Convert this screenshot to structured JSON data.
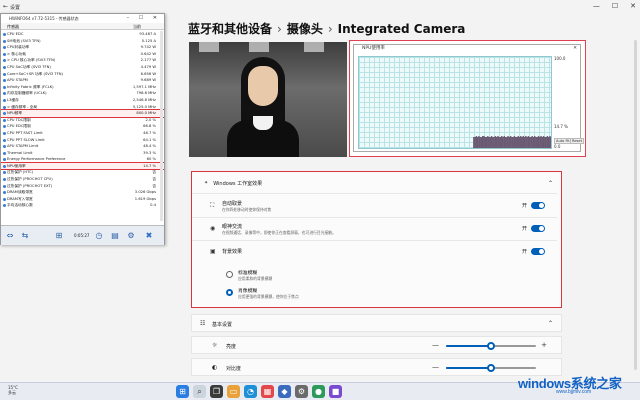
{
  "titlebar": {
    "app_title": "设置",
    "back": "←",
    "minimize": "—",
    "maximize": "☐",
    "close": "✕"
  },
  "breadcrumb": {
    "part1": "蓝牙和其他设备",
    "sep": "›",
    "part2": "摄像头",
    "part3": "Integrated Camera"
  },
  "npu_window": {
    "title": "NPU使用率",
    "close": "✕",
    "axis_top": "100.0",
    "axis_current": "14.7 %",
    "axis_bottom": "0.0",
    "btn_auto": "Auto Fit",
    "btn_reset": "Reset",
    "chart_data": {
      "type": "bar",
      "ylim": [
        0,
        100
      ],
      "values": [
        0,
        0,
        0,
        0,
        0,
        0,
        0,
        0,
        0,
        0,
        0,
        0,
        0,
        0,
        0,
        0,
        0,
        0,
        0,
        0,
        0,
        0,
        0,
        0,
        0,
        0,
        0,
        0,
        0,
        0,
        0,
        0,
        0,
        0,
        0,
        0,
        0,
        0,
        0,
        0,
        0,
        0,
        0,
        0,
        0,
        0,
        0,
        0,
        0,
        0,
        0,
        0,
        0,
        0,
        0,
        0,
        0,
        0,
        0,
        0,
        0,
        0,
        0,
        0,
        0,
        0,
        0,
        0,
        0,
        0,
        0,
        0,
        0,
        0,
        0,
        0,
        0,
        0,
        0,
        0,
        0,
        0,
        0,
        0,
        0,
        0,
        0,
        0,
        0,
        0,
        14,
        14,
        15,
        14,
        15,
        14,
        14,
        15,
        15,
        14,
        14,
        15,
        14,
        14,
        15,
        14,
        14,
        15,
        14,
        15,
        14,
        14,
        15,
        14,
        15,
        14,
        14,
        15,
        14,
        15,
        14,
        14,
        15,
        14,
        14,
        15,
        14,
        15,
        14,
        15,
        14,
        15,
        14,
        15,
        14,
        14,
        15,
        14,
        15,
        14,
        14,
        15,
        14,
        15,
        14,
        15,
        14,
        14,
        15,
        14,
        15,
        14,
        15
      ]
    }
  },
  "effects": {
    "header": "Windows 工作室效果",
    "header_icon": "sparkle-icon",
    "chevron": "⌃",
    "auto_frame": {
      "title": "自动取景",
      "desc": "在你四处移动时使你保持对焦",
      "state": "开"
    },
    "eye_contact": {
      "title": "眼神交流",
      "desc": "在视频通话、录像等中，即使你正在查看屏幕，也可进行目光接触。",
      "state": "开"
    },
    "background": {
      "title": "背景效果",
      "state": "开"
    },
    "standard_blur": {
      "title": "标准模糊",
      "desc": "应用柔和的背景模糊"
    },
    "portrait_blur": {
      "title": "肖像模糊",
      "desc": "应用更强的背景模糊，使你位于焦点"
    }
  },
  "basic": {
    "header": "基本设置",
    "chevron": "⌃",
    "brightness": {
      "label": "亮度",
      "minus": "—",
      "plus": "+",
      "value": 0.5
    },
    "contrast": {
      "label": "对比度",
      "minus": "—",
      "value": 0.5
    }
  },
  "hwinfo": {
    "title": "HWiNFO64 v7.72-5315 - 传感器状态",
    "col_sensor": "传感器",
    "col_current": "当前",
    "rows": [
      {
        "name": "CPU EDC",
        "value": "93.487 A"
      },
      {
        "name": "SM电池 (SVI3 TFN)",
        "value": "0.125 A"
      },
      {
        "name": "CPU封装功率",
        "value": "9.742 W"
      },
      {
        "name": "> 核心功耗",
        "value": "0.642 W"
      },
      {
        "name": "> CPU 核心功率 (SVI3 TFN)",
        "value": "2.177 W"
      },
      {
        "name": "CPU SoC功率 (SVI3 TFN)",
        "value": "4.479 W"
      },
      {
        "name": "Core+SoC+SR 功率 (SVI3 TFN)",
        "value": "6.656 W"
      },
      {
        "name": "APU STAPM",
        "value": "9.689 W"
      },
      {
        "name": "Infinity Fabric 频率 (FCLK)",
        "value": "1,597.1 MHz"
      },
      {
        "name": "内存控制器频率 (UCLK)",
        "value": "798.6 MHz"
      },
      {
        "name": "L3缓存",
        "value": "2,546.8 MHz"
      },
      {
        "name": "> 缓存频率 - 全局",
        "value": "5,125.0 MHz"
      },
      {
        "name": "NPU频率",
        "value": "800.0 MHz"
      },
      {
        "name": "CPU TDC限制",
        "value": "2.0 %"
      },
      {
        "name": "CPU EDC限制",
        "value": "66.8 %"
      },
      {
        "name": "CPU PPT FAST Limit",
        "value": "48.7 %"
      },
      {
        "name": "CPU PPT SLOW Limit",
        "value": "64.1 %"
      },
      {
        "name": "APU STAPM Limit",
        "value": "48.4 %"
      },
      {
        "name": "Thermal Limit",
        "value": "39.3 %"
      },
      {
        "name": "Energy Performance Preference",
        "value": "60 %"
      },
      {
        "name": "NPU使用率",
        "value": "14.7 %"
      },
      {
        "name": "过热保护 (HTC)",
        "value": "否"
      },
      {
        "name": "过热保护 (PROCHOT CPU)",
        "value": "否"
      },
      {
        "name": "过热保护 (PROCHOT EXT)",
        "value": "否"
      },
      {
        "name": "DRAM读取带宽",
        "value": "3.026 Gbps"
      },
      {
        "name": "DRAM写入带宽",
        "value": "1.619 Gbps"
      },
      {
        "name": "平均活动核心数",
        "value": "0.4"
      }
    ],
    "timer": "0:05:27"
  },
  "taskbar": {
    "temp": "15°C",
    "weather": "多云"
  },
  "watermark": {
    "brand": "windows系统之家",
    "url": "www.bjjmlv.com"
  }
}
